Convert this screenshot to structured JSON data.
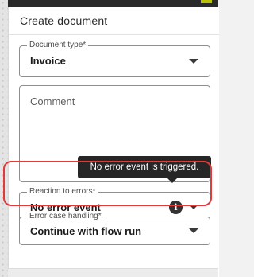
{
  "panel": {
    "title": "Create document"
  },
  "document_type": {
    "label": "Document type*",
    "value": "Invoice"
  },
  "comment": {
    "placeholder": "Comment"
  },
  "reaction_to_errors": {
    "label": "Reaction to errors*",
    "value": "No error event",
    "info_icon": "info-icon",
    "tooltip": "No error event is triggered."
  },
  "error_case_handling": {
    "label": "Error case handling*",
    "value": "Continue with flow run"
  },
  "colors": {
    "highlight": "#e03a3a",
    "tooltip_bg": "#262626",
    "header_bar": "#2a2a2a",
    "accent": "#b8c200"
  }
}
